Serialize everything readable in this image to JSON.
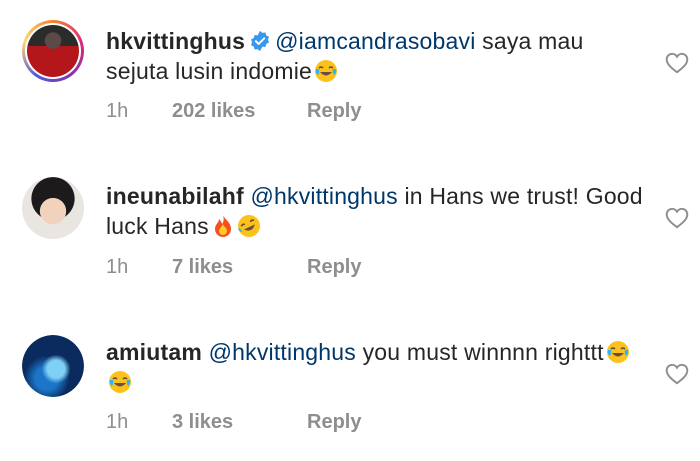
{
  "comments": [
    {
      "username": "hkvittinghus",
      "verified": true,
      "mention": "@iamcandrasobavi",
      "text": " saya mau sejuta lusin indomie",
      "emojis": [
        "face-with-tears-of-joy"
      ],
      "time": "1h",
      "likes": "202 likes",
      "reply": "Reply"
    },
    {
      "username": "ineunabilahf",
      "verified": false,
      "mention": "@hkvittinghus",
      "text": " in Hans we trust! Good luck Hans",
      "emojis": [
        "fire",
        "rolling-on-floor-laughing"
      ],
      "time": "1h",
      "likes": "7 likes",
      "reply": "Reply"
    },
    {
      "username": "amiutam",
      "verified": false,
      "mention": "@hkvittinghus",
      "text": " you must winnnn righttt",
      "emojis": [
        "face-with-tears-of-joy",
        "face-with-tears-of-joy"
      ],
      "time": "1h",
      "likes": "3 likes",
      "reply": "Reply"
    }
  ],
  "colors": {
    "mention": "#00376b",
    "meta": "#8e8e8e",
    "text": "#262626",
    "verified": "#3897f0"
  }
}
